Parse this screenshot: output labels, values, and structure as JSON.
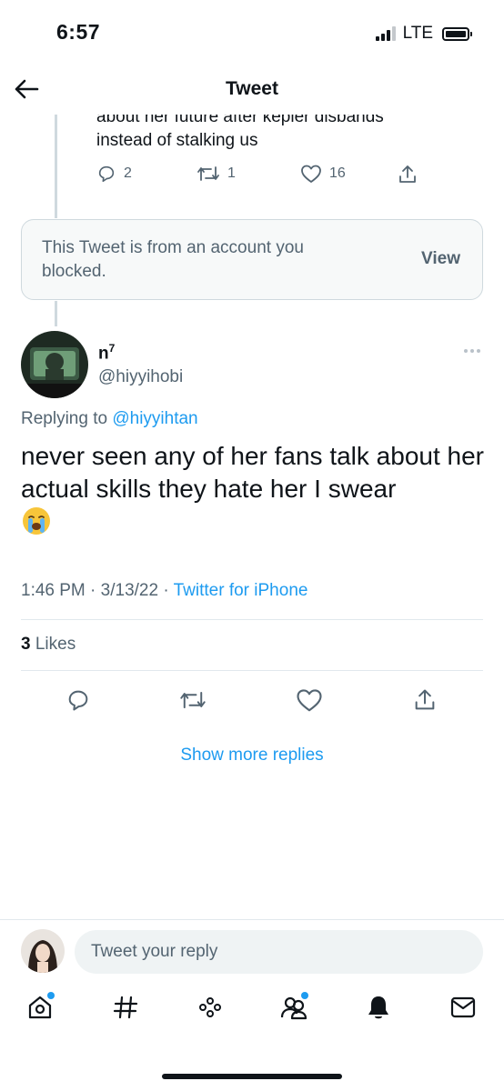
{
  "status_bar": {
    "time": "6:57",
    "network": "LTE"
  },
  "nav": {
    "title": "Tweet"
  },
  "previous_tweet": {
    "text_cut": "about her future after kepler disbands",
    "text_last": "instead of stalking us",
    "replies": "2",
    "retweets": "1",
    "likes": "16"
  },
  "blocked_notice": {
    "text": "This Tweet is from an account you blocked.",
    "view_label": "View"
  },
  "tweet": {
    "display_name": "n",
    "display_name_sup": "7",
    "handle": "@hiyyihobi",
    "replying_prefix": "Replying to",
    "replying_to": "@hiyyihtan",
    "text": "never seen any of her fans talk about her actual skills they hate her I swear",
    "time": "1:46 PM",
    "date": "3/13/22",
    "source": "Twitter for iPhone",
    "likes_count": "3",
    "likes_label": "Likes"
  },
  "show_more_replies": "Show more replies",
  "reply_box": {
    "placeholder": "Tweet your reply"
  },
  "tabbar": {
    "items": [
      "home-icon",
      "explore-icon",
      "spaces-icon",
      "communities-icon",
      "notifications-icon",
      "messages-icon"
    ]
  },
  "colors": {
    "accent": "#1d9bf0",
    "secondary_text": "#536471",
    "border": "#cfd9de"
  }
}
